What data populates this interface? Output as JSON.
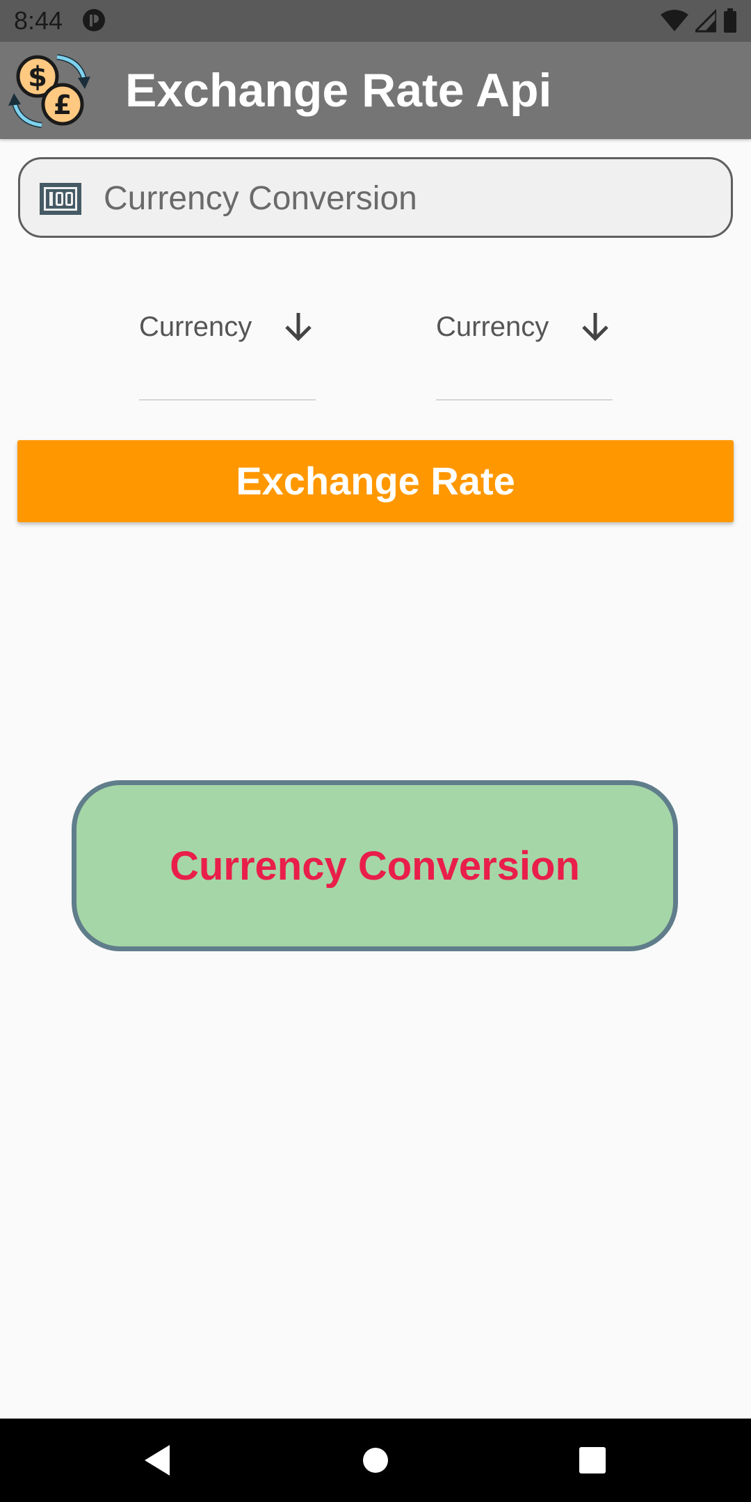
{
  "status_bar": {
    "time": "8:44",
    "icons": [
      "app-notification-icon",
      "wifi-icon",
      "cellular-signal-icon",
      "battery-icon"
    ]
  },
  "app_bar": {
    "title": "Exchange Rate Api",
    "logo_icon": "currency-exchange-logo-icon"
  },
  "amount_field": {
    "placeholder": "Currency Conversion",
    "value": "",
    "icon": "banknote-100-icon"
  },
  "dropdowns": {
    "from": {
      "label": "Currency",
      "icon": "arrow-down-icon"
    },
    "to": {
      "label": "Currency",
      "icon": "arrow-down-icon"
    }
  },
  "exchange_button": {
    "label": "Exchange Rate"
  },
  "result": {
    "text": "Currency Conversion"
  },
  "colors": {
    "app_bar": "#757575",
    "status_bar": "#5A5A5A",
    "button": "#FF9800",
    "result_bg": "#A5D6A7",
    "result_border": "#607D8B",
    "result_text": "#E91E4A"
  },
  "nav_bar": {
    "icons": [
      "back-icon",
      "home-icon",
      "recents-icon"
    ]
  }
}
